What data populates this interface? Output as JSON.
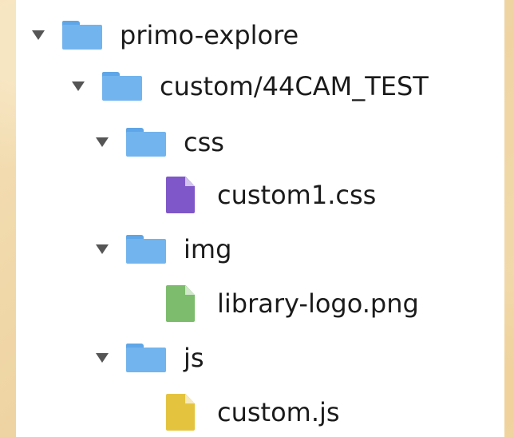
{
  "tree": {
    "root": {
      "label": "primo-explore",
      "icon": "folder-icon",
      "expanded": true
    },
    "custom": {
      "label": "custom/44CAM_TEST",
      "icon": "folder-icon",
      "expanded": true
    },
    "css": {
      "label": "css",
      "icon": "folder-icon",
      "expanded": true
    },
    "css_file": {
      "label": "custom1.css",
      "icon": "css-file-icon",
      "color": "#7f57c8"
    },
    "img": {
      "label": "img",
      "icon": "folder-icon",
      "expanded": true
    },
    "img_file": {
      "label": "library-logo.png",
      "icon": "image-file-icon",
      "color": "#7cbc6c"
    },
    "js": {
      "label": "js",
      "icon": "folder-icon",
      "expanded": true
    },
    "js_file": {
      "label": "custom.js",
      "icon": "js-file-icon",
      "color": "#e4c43e"
    }
  },
  "colors": {
    "folder": "#72b4ee",
    "arrow": "#555555",
    "background": "#f3ddb2"
  }
}
